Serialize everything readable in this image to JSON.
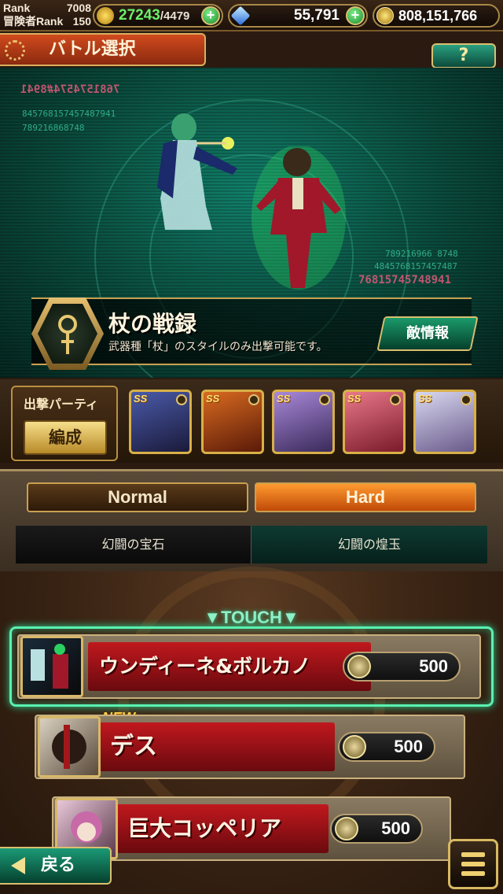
{
  "status": {
    "rank_label": "Rank",
    "rank_value": "7008",
    "adv_rank_label": "冒険者Rank",
    "adv_rank_value": "150",
    "stamina_current": "27243",
    "stamina_max": "/4479",
    "gems": "55,791",
    "gold": "808,151,766"
  },
  "header": {
    "title": "バトル選択",
    "help_label": "?"
  },
  "scene": {
    "code_top": "7681574574#8941",
    "code_line1": "845768157457487941",
    "code_line2": "789216868748",
    "code_right1": "789216966 8748",
    "code_right2": "4845768157457487",
    "code_right3": "76815745748941"
  },
  "event": {
    "title": "杖の戦録",
    "description": "武器種「杖」のスタイルのみ出撃可能です。",
    "enemy_info_label": "敵情報"
  },
  "party": {
    "label": "出撃パーティ",
    "formation_label": "編成",
    "slot_tag": "SS",
    "slot_colors": [
      "#2a3a6a",
      "#8a2a10",
      "#6a4a8a",
      "#b84a5a",
      "#8a8aa8"
    ]
  },
  "difficulty": {
    "normal_label": "Normal",
    "hard_label": "Hard",
    "selected": "Hard",
    "gem_left": "幻闘の宝石",
    "gem_right": "幻闘の煌玉"
  },
  "quests": {
    "touch_label": "▼TOUCH▼",
    "new_label": "NEW",
    "items": [
      {
        "name": "ウンディーネ&ボルカノ",
        "cost": "500"
      },
      {
        "name": "デス",
        "cost": "500"
      },
      {
        "name": "巨大コッペリア",
        "cost": "500"
      }
    ]
  },
  "footer": {
    "back_label": "戻る"
  },
  "colors": {
    "accent_green": "#2ad090",
    "hard_orange": "#ff9a30",
    "quest_red": "#c0181e",
    "gold_border": "#d8b860"
  }
}
